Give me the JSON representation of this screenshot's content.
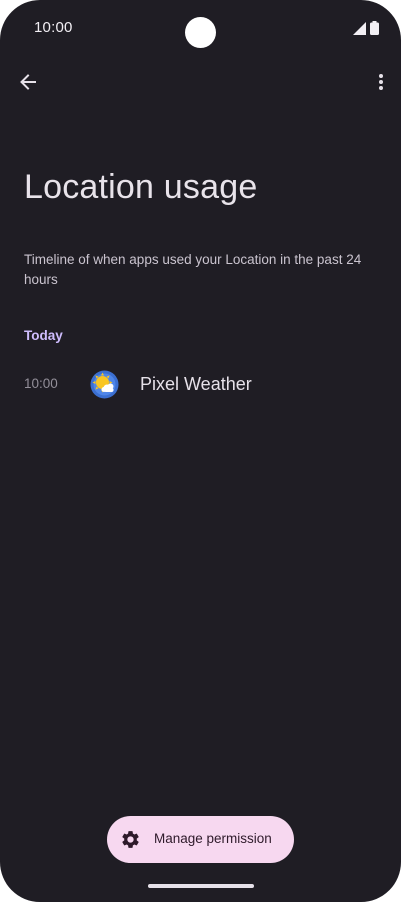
{
  "status_bar": {
    "time": "10:00"
  },
  "app_bar": {
    "back_icon": "arrow-back-icon",
    "more_icon": "more-vert-icon"
  },
  "page": {
    "title": "Location usage",
    "subtitle": "Timeline of when apps used your Location in the past 24 hours"
  },
  "timeline": {
    "section_label": "Today",
    "entries": [
      {
        "time": "10:00",
        "app_name": "Pixel Weather",
        "icon": "pixel-weather-app-icon"
      }
    ]
  },
  "footer": {
    "manage_label": "Manage permission",
    "manage_icon": "settings-gear-icon"
  },
  "colors": {
    "background": "#1f1d24",
    "accent": "#cfbdfe",
    "button_bg": "#f7d8f0"
  }
}
